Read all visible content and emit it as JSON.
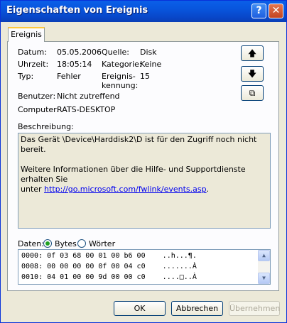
{
  "window": {
    "title": "Eigenschaften von Ereignis",
    "help_glyph": "?",
    "close_glyph": "✕"
  },
  "tab": {
    "label": "Ereignis"
  },
  "fields": {
    "datum_label": "Datum:",
    "datum_value": "05.05.2006",
    "quelle_label": "Quelle:",
    "quelle_value": "Disk",
    "uhrzeit_label": "Uhrzeit:",
    "uhrzeit_value": "18:05:14",
    "kategorie_label": "Kategorie:",
    "kategorie_value": "Keine",
    "typ_label": "Typ:",
    "typ_value": "Fehler",
    "kennung_label_1": "Ereignis-",
    "kennung_label_2": "kennung:",
    "kennung_value": "15",
    "benutzer_label": "Benutzer:",
    "benutzer_value": "Nicht zutreffend",
    "computer_label": "Computer:",
    "computer_value": "RATS-DESKTOP"
  },
  "nav_buttons": {
    "up": "🡅",
    "down": "🡇",
    "copy": "⧉"
  },
  "description": {
    "label": "Beschreibung:",
    "line1": "Das Gerät \\Device\\Harddisk2\\D ist für den Zugriff noch nicht bereit.",
    "line2": "Weitere Informationen über die Hilfe- und Supportdienste erhalten Sie",
    "line3_prefix": "unter ",
    "link": "http://go.microsoft.com/fwlink/events.asp",
    "line3_suffix": "."
  },
  "data_section": {
    "label": "Daten:",
    "bytes_label": "Bytes",
    "words_label": "Wörter",
    "selected": "Bytes",
    "rows": [
      "0000: 0f 03 68 00 01 00 b6 00    ..h...¶.",
      "0008: 00 00 00 00 0f 00 04 c0    .......À",
      "0010: 04 01 00 00 9d 00 00 c0    ....□..À"
    ]
  },
  "scroll_icons": {
    "up": "▲",
    "down": "▼"
  },
  "buttons": {
    "ok": "OK",
    "cancel": "Abbrechen",
    "apply": "Übernehmen"
  }
}
